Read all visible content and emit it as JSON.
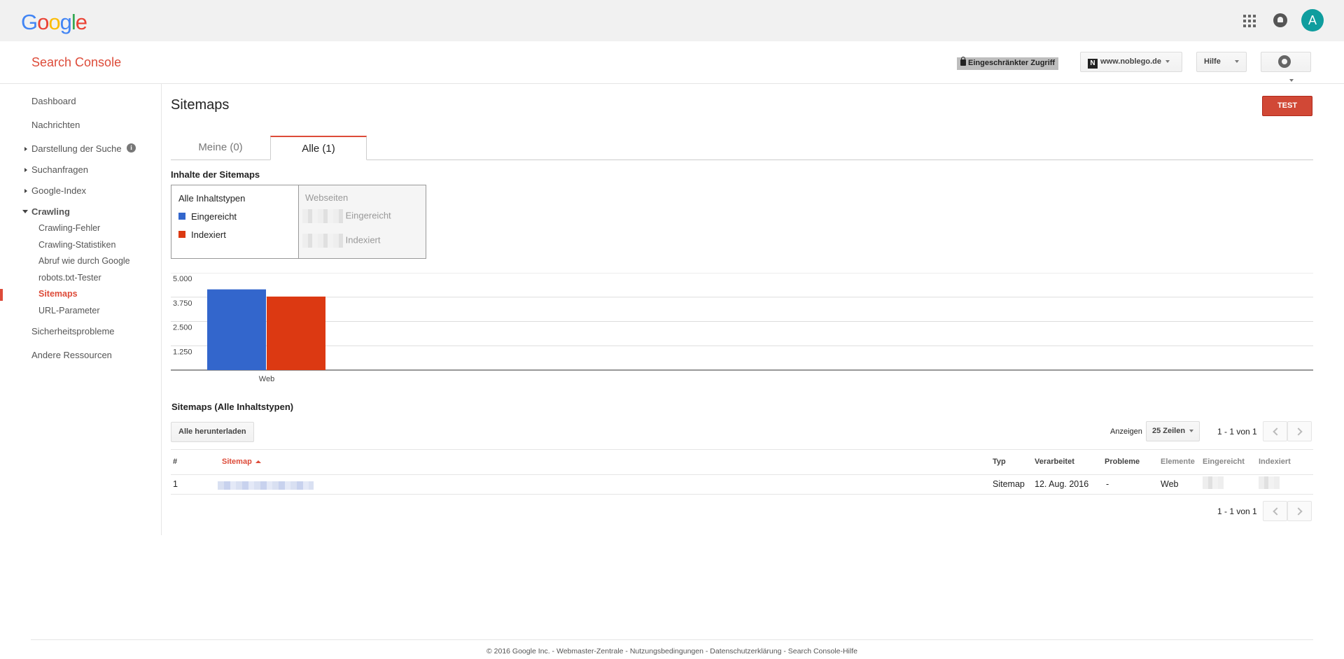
{
  "google": {
    "logo_letters": [
      {
        "ch": "G",
        "color": "#4285F4"
      },
      {
        "ch": "o",
        "color": "#EA4335"
      },
      {
        "ch": "o",
        "color": "#FBBC05"
      },
      {
        "ch": "g",
        "color": "#4285F4"
      },
      {
        "ch": "l",
        "color": "#34A853"
      },
      {
        "ch": "e",
        "color": "#EA4335"
      }
    ],
    "avatar_letter": "A"
  },
  "header": {
    "app_title": "Search Console",
    "restricted": "Eingeschränkter Zugriff",
    "site_favicon": "N",
    "site": "www.noblego.de",
    "help": "Hilfe"
  },
  "sidebar": {
    "dashboard": "Dashboard",
    "messages": "Nachrichten",
    "search_appearance": "Darstellung der Suche",
    "search_traffic": "Suchanfragen",
    "google_index": "Google-Index",
    "crawl": "Crawling",
    "crawl_items": [
      "Crawling-Fehler",
      "Crawling-Statistiken",
      "Abruf wie durch Google",
      "robots.txt-Tester",
      "Sitemaps",
      "URL-Parameter"
    ],
    "security": "Sicherheitsprobleme",
    "other_resources": "Andere Ressourcen"
  },
  "main": {
    "title": "Sitemaps",
    "test_button": "TEST",
    "tabs": [
      "Meine (0)",
      "Alle (1)"
    ],
    "contents_title": "Inhalte der Sitemaps",
    "legend": {
      "all_types": "Alle Inhaltstypen",
      "submitted": "Eingereicht",
      "indexed": "Indexiert",
      "webpages": "Webseiten"
    },
    "table_title": "Sitemaps (Alle Inhaltstypen)",
    "download_all": "Alle herunterladen",
    "show": "Anzeigen",
    "rows_option": "25 Zeilen",
    "pager": "1 - 1 von 1",
    "columns": [
      "#",
      "Sitemap",
      "Typ",
      "Verarbeitet",
      "Probleme",
      "Elemente",
      "Eingereicht",
      "Indexiert"
    ],
    "row": {
      "num": "1",
      "type": "Sitemap",
      "processed": "12. Aug. 2016",
      "issues": "-",
      "elements": "Web"
    }
  },
  "chart_data": {
    "type": "bar",
    "categories": [
      "Web"
    ],
    "series": [
      {
        "name": "Eingereicht",
        "color": "#3366cc",
        "values": [
          4150
        ]
      },
      {
        "name": "Indexiert",
        "color": "#dc3912",
        "values": [
          3780
        ]
      }
    ],
    "yticks": [
      "1.250",
      "2.500",
      "3.750",
      "5.000"
    ],
    "ytick_values": [
      1250,
      2500,
      3750,
      5000
    ],
    "ylim": [
      0,
      5000
    ],
    "grid": true
  },
  "footer": {
    "copyright": "© 2016 Google Inc.",
    "links": [
      "Webmaster-Zentrale",
      "Nutzungsbedingungen",
      "Datenschutzerklärung",
      "Search Console-Hilfe"
    ]
  }
}
